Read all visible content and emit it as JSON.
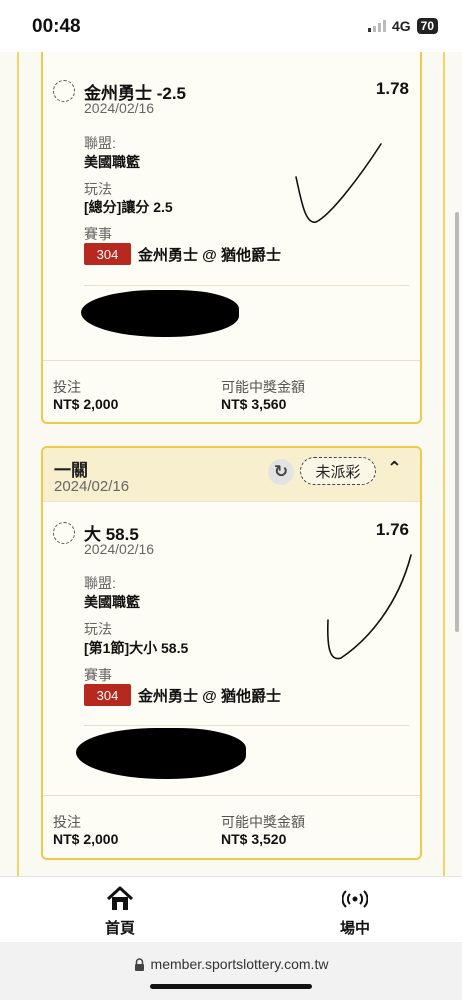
{
  "status_bar": {
    "time": "00:48",
    "network": "4G",
    "battery": "70"
  },
  "bets": [
    {
      "header": null,
      "pick": "金州勇士 -2.5",
      "date": "2024/02/16",
      "odds": "1.78",
      "league_label": "聯盟:",
      "league": "美國職籃",
      "play_label": "玩法",
      "play": "[總分]讓分 2.5",
      "event_label": "賽事",
      "event_id": "304",
      "event": "金州勇士 @ 猶他爵士",
      "stake_label": "投注",
      "stake": "NT$ 2,000",
      "payout_label": "可能中獎金額",
      "payout": "NT$ 3,560"
    },
    {
      "header": {
        "title": "一關",
        "date": "2024/02/16",
        "status": "未派彩"
      },
      "pick": "大 58.5",
      "date": "2024/02/16",
      "odds": "1.76",
      "league_label": "聯盟:",
      "league": "美國職籃",
      "play_label": "玩法",
      "play": "[第1節]大小 58.5",
      "event_label": "賽事",
      "event_id": "304",
      "event": "金州勇士 @ 猶他爵士",
      "stake_label": "投注",
      "stake": "NT$ 2,000",
      "payout_label": "可能中獎金額",
      "payout": "NT$ 3,520"
    }
  ],
  "nav": {
    "home": "首頁",
    "live": "場中"
  },
  "browser": {
    "url": "member.sportslottery.com.tw"
  },
  "colors": {
    "accent": "#f2c84b",
    "event_tag": "#b7281f",
    "header_bg": "#f8efce"
  }
}
